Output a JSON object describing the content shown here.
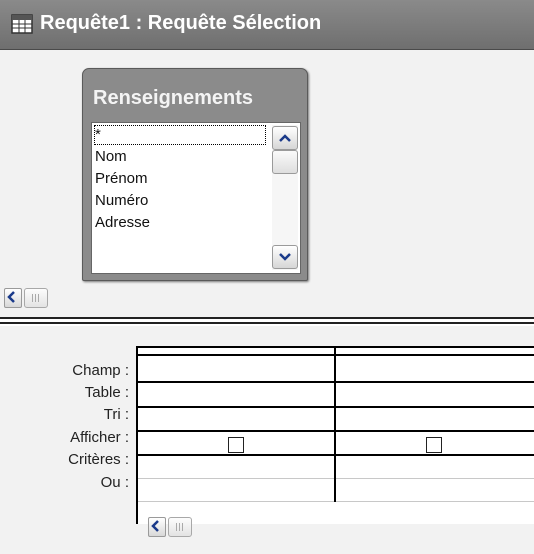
{
  "window": {
    "title": "Requête1 : Requête Sélection",
    "icon": "query-datasheet-icon"
  },
  "table_box": {
    "title": "Renseignements",
    "fields": [
      "*",
      "Nom",
      "Prénom",
      "Numéro",
      "Adresse"
    ],
    "selected_field": "*"
  },
  "grid": {
    "row_labels": [
      "Champ :",
      "Table :",
      "Tri :",
      "Afficher :",
      "Critères :",
      "Ou :"
    ],
    "columns": [
      {
        "champ": "",
        "table": "",
        "tri": "",
        "afficher": false,
        "criteres": "",
        "ou": ""
      },
      {
        "champ": "",
        "table": "",
        "tri": "",
        "afficher": false,
        "criteres": "",
        "ou": ""
      }
    ]
  },
  "colors": {
    "titlebar": "#7a7a7a",
    "table_box_header": "#8b8b8b",
    "pane_background": "#f2f2f2"
  }
}
